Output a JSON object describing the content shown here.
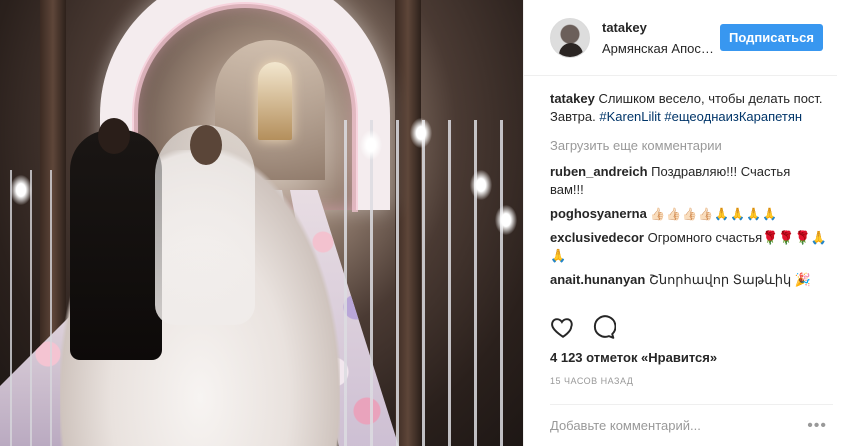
{
  "post": {
    "username": "tatakey",
    "location": "Армянская Апос…",
    "follow_label": "Подписаться",
    "caption": {
      "user": "tatakey",
      "text": "Слишком весело, чтобы делать пост. Завтра.",
      "tags": [
        "#KarenLilit",
        "#ещеоднаизКарапетян"
      ]
    },
    "load_more": "Загрузить еще комментарии",
    "comments": [
      {
        "user": "ruben_andreich",
        "text": "Поздравляю!!! Счастья вам!!!"
      },
      {
        "user": "poghosyanerna",
        "text": "👍🏻👍🏻👍🏻👍🏻🙏🙏🙏🙏"
      },
      {
        "user": "exclusivedecor",
        "text": "Огромного счастья🌹🌹🌹🙏🙏"
      },
      {
        "user": "anait.hunanyan",
        "text": "Շնորհավոր Տաթևիկ 🎉"
      }
    ],
    "likes": "4 123 отметок «Нравится»",
    "time": "15 часов назад",
    "add_comment_placeholder": "Добавьте комментарий...",
    "more_icon": "ellipsis-icon"
  },
  "icons": {
    "like": "heart-icon",
    "comment": "comment-bubble-icon"
  },
  "colors": {
    "follow_button": "#3897f0",
    "hashtag": "#003569",
    "muted": "#999999"
  }
}
